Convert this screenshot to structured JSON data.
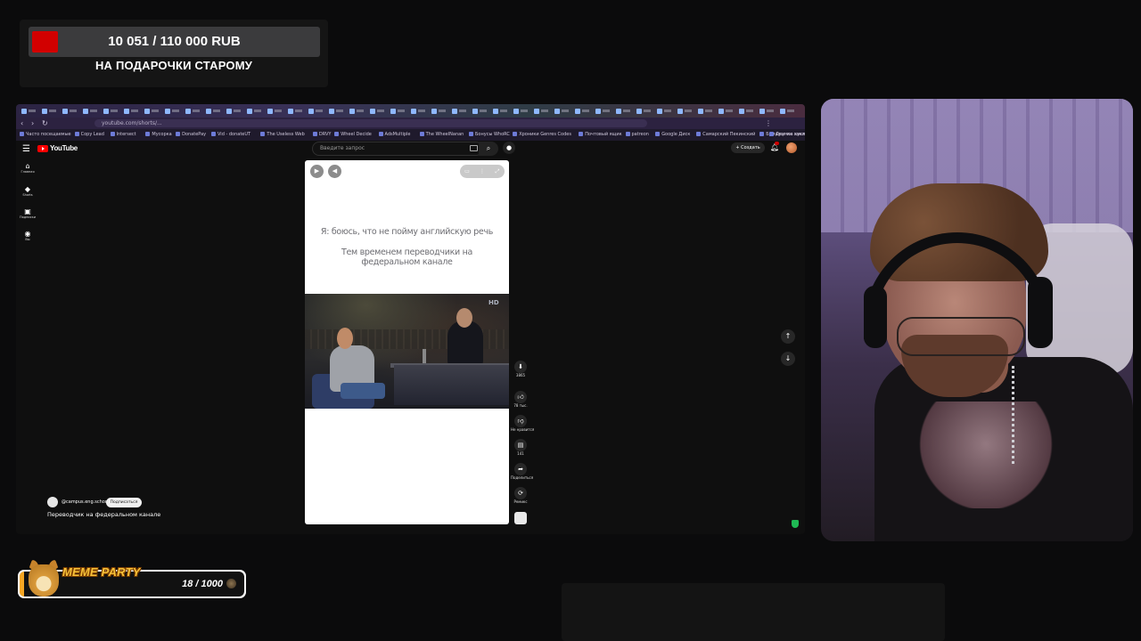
{
  "goal": {
    "amount": "10 051 / 110 000 RUB",
    "label": "НА ПОДАРОЧКИ СТАРОМУ",
    "progress": 0.09,
    "fill_color": "#d20000"
  },
  "browser": {
    "url": "youtube.com/shorts/...",
    "bookmarks": [
      "Часто посещаемые",
      "Сору Lead",
      "Intersect",
      "Мусорка",
      "DonatePay",
      "Vid - donateUT",
      "The Useless Web",
      "DRVY",
      "Wheel Decide",
      "AdsMultiple",
      "The WheelNanan",
      "Бонусы WhoRC",
      "Хроники Genres Codes",
      "Почтовый ящик",
      "patreon",
      "Google Диск",
      "Самарский Пекинский",
      "Бумажинка кукла",
      "Момент и знания пр",
      "Другие закладки"
    ]
  },
  "youtube": {
    "logo_text": "YouTube",
    "search_placeholder": "Введите запрос",
    "create_label": "Создать",
    "sidebar": [
      {
        "icon": "home-icon",
        "label": "Главная"
      },
      {
        "icon": "shorts-icon",
        "label": "Shorts"
      },
      {
        "icon": "subscriptions-icon",
        "label": "Подписки"
      },
      {
        "icon": "you-icon",
        "label": "Вы"
      }
    ],
    "short": {
      "caption_line1": "Я: боюсь, что не пойму английскую речь",
      "caption_line2": "Тем временем переводчики на федеральном канале",
      "channel": "@campus.eng.school",
      "subscribe": "Подписаться",
      "title": "Переводчик на федеральном канале"
    },
    "actions": {
      "views": "3865",
      "likes": "78 тыс.",
      "dislike": "Не нравится",
      "comments": "141",
      "share": "Поделиться",
      "remix": "Ремикс"
    }
  },
  "meme_party": {
    "title": "MEME PARTY",
    "count": "18 / 1000",
    "progress": 0.018
  }
}
